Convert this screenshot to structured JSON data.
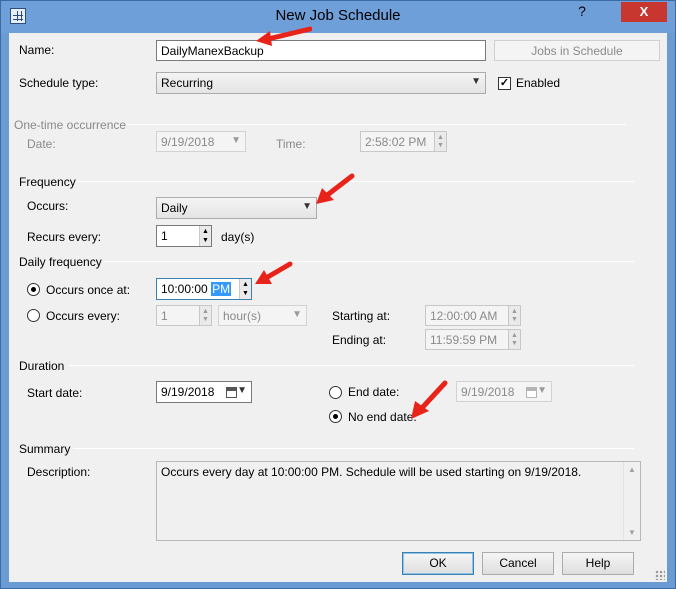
{
  "window": {
    "title": "New Job Schedule",
    "help_label": "?",
    "close_label": "X",
    "icon": "table-grid-icon"
  },
  "name": {
    "label": "Name:",
    "value": "DailyManexBackup",
    "jobs_button": "Jobs in Schedule"
  },
  "schedule_type": {
    "label": "Schedule type:",
    "value": "Recurring",
    "enabled_label": "Enabled",
    "enabled_checked": true
  },
  "one_time": {
    "group_label": "One-time occurrence",
    "date_label": "Date:",
    "date_value": "9/19/2018",
    "time_label": "Time:",
    "time_value": "2:58:02 PM"
  },
  "frequency": {
    "group_label": "Frequency",
    "occurs_label": "Occurs:",
    "occurs_value": "Daily",
    "recurs_label": "Recurs every:",
    "recurs_value": "1",
    "recurs_unit": "day(s)"
  },
  "daily_frequency": {
    "group_label": "Daily frequency",
    "once_label": "Occurs once at:",
    "once_time": "10:00:00",
    "once_ampm": "PM",
    "every_label": "Occurs every:",
    "every_value": "1",
    "every_unit": "hour(s)",
    "starting_label": "Starting at:",
    "starting_value": "12:00:00 AM",
    "ending_label": "Ending at:",
    "ending_value": "11:59:59 PM",
    "selected": "once"
  },
  "duration": {
    "group_label": "Duration",
    "start_label": "Start date:",
    "start_value": "9/19/2018",
    "end_label": "End date:",
    "end_value": "9/19/2018",
    "no_end_label": "No end date:",
    "selected": "no_end"
  },
  "summary": {
    "group_label": "Summary",
    "description_label": "Description:",
    "description_value": "Occurs every day at 10:00:00 PM. Schedule will be used starting on 9/19/2018."
  },
  "buttons": {
    "ok": "OK",
    "cancel": "Cancel",
    "help": "Help"
  },
  "colors": {
    "titlebar": "#6f9fd8",
    "close": "#c7372f",
    "annotation_arrow": "#e8231a",
    "selection": "#3399ff"
  },
  "annotations": {
    "arrow_icon": "red-arrow-icon",
    "count": 5
  }
}
